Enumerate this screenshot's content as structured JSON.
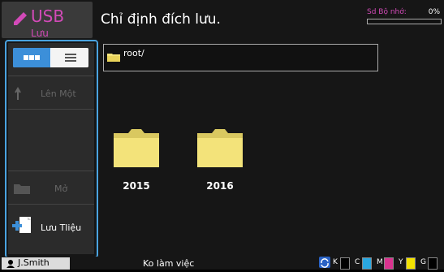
{
  "header": {
    "mode_title": "USB",
    "mode_subtitle": "Lưu",
    "screen_title": "Chỉ định đích lưu.",
    "memory_label": "Sd Bộ nhớ:",
    "memory_percent": "0%",
    "memory_fraction": 0
  },
  "sidebar": {
    "up_label": "Lên Một",
    "open_label": "Mở",
    "save_label": "Lưu Tliệu"
  },
  "path": {
    "text": "root/"
  },
  "folders": [
    {
      "label": "2015"
    },
    {
      "label": "2016"
    }
  ],
  "footer": {
    "user": "J.Smith",
    "status": "Ko làm việc",
    "inks": [
      {
        "letter": "K",
        "color": "#000000"
      },
      {
        "letter": "C",
        "color": "#2aa7e0"
      },
      {
        "letter": "M",
        "color": "#d9338f"
      },
      {
        "letter": "Y",
        "color": "#f2e100"
      },
      {
        "letter": "G",
        "color": "#000000"
      }
    ]
  },
  "colors": {
    "accent": "#d24ab8",
    "frame": "#4aa3e0",
    "folder": "#f3e37a"
  }
}
